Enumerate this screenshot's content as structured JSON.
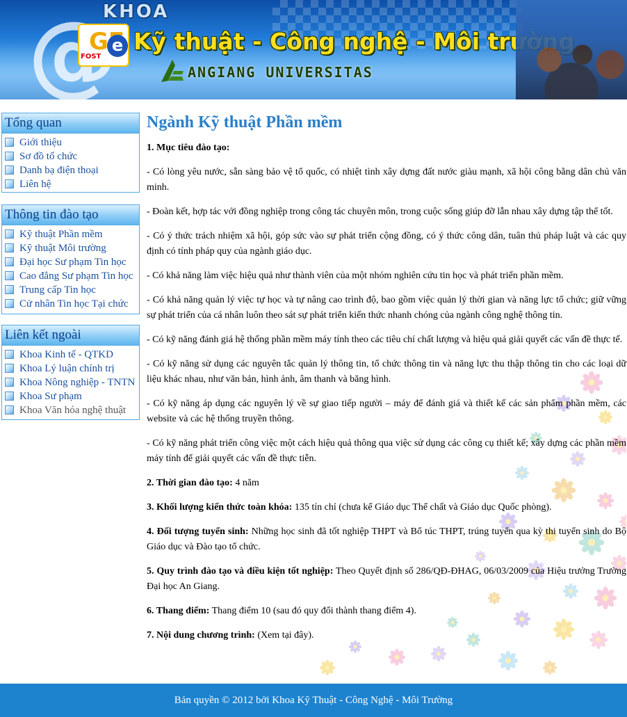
{
  "header": {
    "khoa_label": "KHOA",
    "logo_main": "GE",
    "logo_e": "e",
    "logo_small": "FOST",
    "faculty_name": "Kỹ thuật - Công nghệ - Môi trường",
    "university_name": "ANGIANG UNIVERSITAS",
    "at_symbol": "@"
  },
  "sidebar": {
    "overview": {
      "title": "Tổng quan",
      "items": [
        "Giới thiệu",
        "Sơ đồ tổ chức",
        "Danh bạ điện thoại",
        "Liên hệ"
      ]
    },
    "training": {
      "title": "Thông tin đào tạo",
      "items": [
        "Kỹ thuật Phần mềm",
        "Kỹ thuật Môi trường",
        "Đại học Sư phạm Tin học",
        "Cao đẳng Sư phạm Tin học",
        "Trung cấp Tin học",
        "Cử nhân Tin học Tại chức"
      ]
    },
    "links": {
      "title": "Liên kết ngoài",
      "items": [
        "Khoa Kinh tế - QTKD",
        "Khoa Lý luận chính trị",
        "Khoa Nông nghiệp - TNTN",
        "Khoa Sư phạm",
        "Khoa Văn hóa nghệ thuật"
      ]
    }
  },
  "main": {
    "title": "Ngành Kỹ thuật Phần mềm",
    "objectives_heading": "1. Mục tiêu đào tạo:",
    "objectives": [
      "- Có lòng yêu nước, sẵn sàng bảo vệ tổ quốc, có nhiệt tình xây dựng đất nước giàu mạnh, xã hội công bằng dân chủ văn minh.",
      "- Đoàn kết, hợp tác với đồng nghiệp trong công tác chuyên môn, trong cuộc sống giúp đỡ lẫn nhau xây dựng tập thể tốt.",
      "- Có ý thức trách nhiệm xã hội, góp sức vào sự phát triển cộng đồng, có ý thức công dân, tuân thủ pháp luật và các quy định có tính pháp quy của ngành giáo dục.",
      "- Có khả năng làm việc hiệu quả như thành viên của một nhóm nghiên cứu tin học và phát triển phần mềm.",
      "- Có khả năng quản lý việc tự học và tự nâng cao trình độ, bao gồm việc quản lý thời gian và năng lực tổ chức; giữ vững sự phát triển của cá nhân luôn theo sát sự phát triển kiến thức nhanh chóng của ngành công nghệ thông tin.",
      "- Có kỹ năng đánh giá hệ thống phần mềm máy tính theo các tiêu chí chất lượng và hiệu quả giải quyết các vấn đề thực tế.",
      "- Có kỹ năng sử dụng các nguyên tắc quản lý thông tin, tổ chức thông tin và năng lực thu thập thông tin cho các loại dữ liệu khác nhau, như văn bản, hình ảnh, âm thanh và băng hình.",
      "- Có kỹ năng áp dụng các nguyên lý về sự giao tiếp người – máy để đánh giá và thiết kế các sản phẩm phần mềm, các website và các hệ thống truyền thông.",
      "- Có kỹ năng phát triển công việc một cách hiệu quả thông qua việc sử dụng các công cụ thiết kế; xây dựng các phần mềm máy tính để giải quyết các vấn đề thực tiễn."
    ],
    "duration": {
      "label": "2. Thời gian đào tạo:",
      "value": " 4 năm"
    },
    "credits": {
      "label": "3. Khối lượng kiến thức toàn khóa:",
      "value": " 135 tín chỉ (chưa kể Giáo dục Thể chất và Giáo dục Quốc phòng)."
    },
    "admission": {
      "label": "4. Đối tượng tuyển sinh:",
      "value": " Những học sinh đã tốt nghiệp THPT và Bổ túc THPT, trúng tuyển qua kỳ thi tuyển sinh do Bộ Giáo dục và Đào tạo tổ chức."
    },
    "process": {
      "label": "5. Quy trình đào tạo và điều kiện tốt nghiệp:",
      "value": " Theo Quyết định số 286/QĐ-ĐHAG, 06/03/2009 của Hiệu trưởng Trường Đại học An Giang."
    },
    "grading": {
      "label": "6. Thang điểm:",
      "value": " Thang điểm 10 (sau đó quy đổi thành thang điểm 4)."
    },
    "program": {
      "label": "7. Nội dung chương trình:",
      "value": " (Xem tại đây)."
    }
  },
  "footer": {
    "copyright": "Bản quyền © 2012 bởi Khoa Kỹ Thuật - Công Nghệ - Môi Trường"
  },
  "colors": {
    "accent": "#2b7fc8",
    "link": "#1a4f9e",
    "footer_bg": "#1d83cf",
    "box_border": "#51a9e2"
  }
}
